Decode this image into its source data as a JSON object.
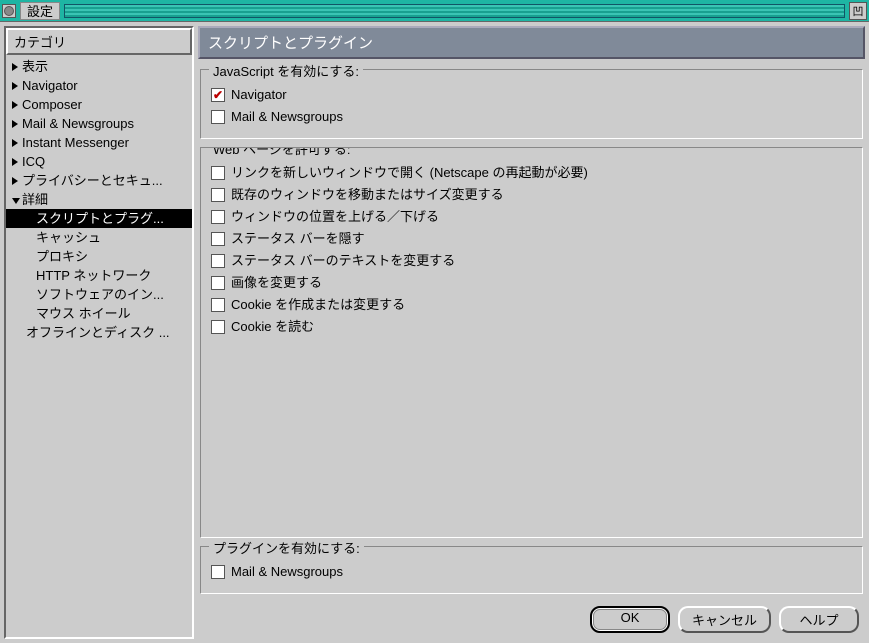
{
  "window": {
    "title": "設定"
  },
  "sidebar": {
    "header": "カテゴリ",
    "items": [
      {
        "label": "表示",
        "kind": "closed"
      },
      {
        "label": "Navigator",
        "kind": "closed"
      },
      {
        "label": "Composer",
        "kind": "closed"
      },
      {
        "label": "Mail & Newsgroups",
        "kind": "closed"
      },
      {
        "label": "Instant Messenger",
        "kind": "closed"
      },
      {
        "label": "ICQ",
        "kind": "closed"
      },
      {
        "label": "プライバシーとセキュ...",
        "kind": "closed"
      },
      {
        "label": "詳細",
        "kind": "open"
      },
      {
        "label": "スクリプトとプラグ...",
        "kind": "child",
        "selected": true
      },
      {
        "label": "キャッシュ",
        "kind": "child"
      },
      {
        "label": "プロキシ",
        "kind": "child"
      },
      {
        "label": "HTTP ネットワーク",
        "kind": "child"
      },
      {
        "label": "ソフトウェアのイン...",
        "kind": "child"
      },
      {
        "label": "マウス ホイール",
        "kind": "child"
      },
      {
        "label": "オフラインとディスク ...",
        "kind": "sub"
      }
    ]
  },
  "main": {
    "title": "スクリプトとプラグイン",
    "group_js": {
      "title": "JavaScript を有効にする:",
      "items": [
        {
          "label": "Navigator",
          "checked": true
        },
        {
          "label": "Mail & Newsgroups",
          "checked": false
        }
      ]
    },
    "group_web": {
      "title": "Web ページを許可する:",
      "items": [
        {
          "label": "リンクを新しいウィンドウで開く (Netscape の再起動が必要)",
          "checked": false
        },
        {
          "label": "既存のウィンドウを移動またはサイズ変更する",
          "checked": false
        },
        {
          "label": "ウィンドウの位置を上げる／下げる",
          "checked": false
        },
        {
          "label": "ステータス バーを隠す",
          "checked": false
        },
        {
          "label": "ステータス バーのテキストを変更する",
          "checked": false
        },
        {
          "label": "画像を変更する",
          "checked": false
        },
        {
          "label": "Cookie を作成または変更する",
          "checked": false
        },
        {
          "label": "Cookie を読む",
          "checked": false
        }
      ]
    },
    "group_plugin": {
      "title": "プラグインを有効にする:",
      "items": [
        {
          "label": "Mail & Newsgroups",
          "checked": false
        }
      ]
    }
  },
  "buttons": {
    "ok": "OK",
    "cancel": "キャンセル",
    "help": "ヘルプ"
  }
}
